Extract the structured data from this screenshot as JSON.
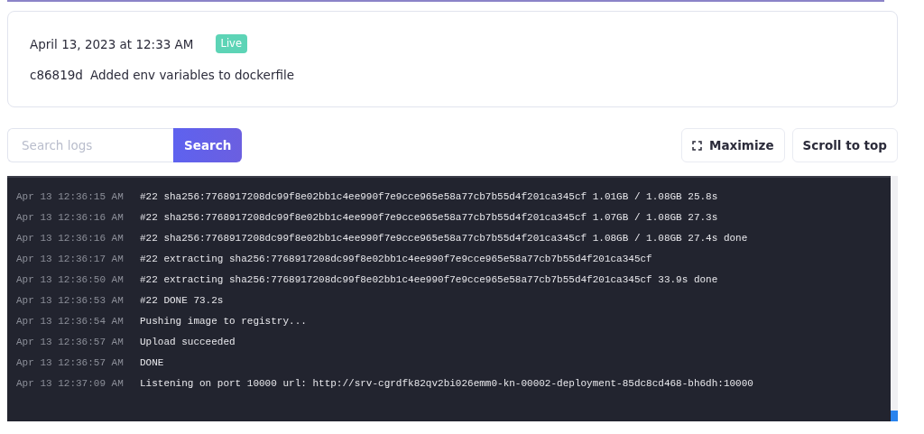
{
  "deploy": {
    "date": "April 13, 2023 at 12:33 AM",
    "status": {
      "label": "Live",
      "kind": "live"
    },
    "commit_hash": "c86819d",
    "commit_message": "Added env variables to dockerfile"
  },
  "search": {
    "placeholder": "Search logs",
    "button": "Search"
  },
  "actions": [
    {
      "label": "Maximize",
      "kind": "maximize"
    },
    {
      "label": "Scroll to top",
      "kind": "plain"
    }
  ],
  "logs": [
    {
      "time": "Apr 13 12:36:15 AM",
      "message": "#22 sha256:7768917208dc99f8e02bb1c4ee990f7e9cce965e58a77cb7b55d4f201ca345cf 1.01GB / 1.08GB 25.8s"
    },
    {
      "time": "Apr 13 12:36:16 AM",
      "message": "#22 sha256:7768917208dc99f8e02bb1c4ee990f7e9cce965e58a77cb7b55d4f201ca345cf 1.07GB / 1.08GB 27.3s"
    },
    {
      "time": "Apr 13 12:36:16 AM",
      "message": "#22 sha256:7768917208dc99f8e02bb1c4ee990f7e9cce965e58a77cb7b55d4f201ca345cf 1.08GB / 1.08GB 27.4s done"
    },
    {
      "time": "Apr 13 12:36:17 AM",
      "message": "#22 extracting sha256:7768917208dc99f8e02bb1c4ee990f7e9cce965e58a77cb7b55d4f201ca345cf"
    },
    {
      "time": "Apr 13 12:36:50 AM",
      "message": "#22 extracting sha256:7768917208dc99f8e02bb1c4ee990f7e9cce965e58a77cb7b55d4f201ca345cf 33.9s done"
    },
    {
      "time": "Apr 13 12:36:53 AM",
      "message": "#22 DONE 73.2s"
    },
    {
      "time": "Apr 13 12:36:54 AM",
      "message": "Pushing image to registry..."
    },
    {
      "time": "Apr 13 12:36:57 AM",
      "message": "Upload succeeded"
    },
    {
      "time": "Apr 13 12:36:57 AM",
      "message": "DONE"
    },
    {
      "time": "Apr 13 12:37:09 AM",
      "message": "Listening on port 10000 url: http://srv-cgrdfk82qv2bi026emm0-kn-00002-deployment-85dc8cd468-bh6dh:10000"
    }
  ]
}
